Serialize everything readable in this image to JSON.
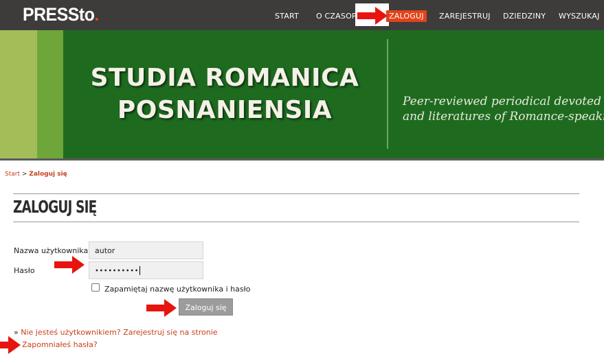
{
  "header": {
    "logo_text": "PRESSto",
    "logo_dot": ".",
    "nav": [
      {
        "label": "START"
      },
      {
        "label": "O CZASOPIŚ"
      },
      {
        "label": "ZALOGUJ"
      },
      {
        "label": "ZAREJESTRUJ"
      },
      {
        "label": "DZIEDZINY"
      },
      {
        "label": "WYSZUKAJ"
      }
    ],
    "active_color": "#e2431b"
  },
  "banner": {
    "title_line1": "STUDIA ROMANICA",
    "title_line2": "POSNANIENSIA",
    "subtitle_line1": "Peer-reviewed periodical devoted to",
    "subtitle_line2": "and literatures of Romance-speaking"
  },
  "breadcrumb": {
    "home": "Start",
    "separator": ">",
    "current": "Zaloguj się"
  },
  "login": {
    "title": "ZALOGUJ SIĘ",
    "username_label": "Nazwa użytkownika",
    "username_value": "autor",
    "password_label": "Hasło",
    "password_value": "••••••••••",
    "remember_label": "Zapamiętaj nazwę użytkownika i hasło",
    "remember_checked": false,
    "submit_label": "Zaloguj się"
  },
  "links": {
    "bullet": "»",
    "register": "Nie jesteś użytkownikiem? Zarejestruj się na stronie",
    "forgot": "Zapomniałeś hasła?"
  },
  "colors": {
    "accent": "#e2431b",
    "arrow": "#e8140f",
    "banner_green": "#1e6b20",
    "topbar": "#3d3c3a"
  }
}
